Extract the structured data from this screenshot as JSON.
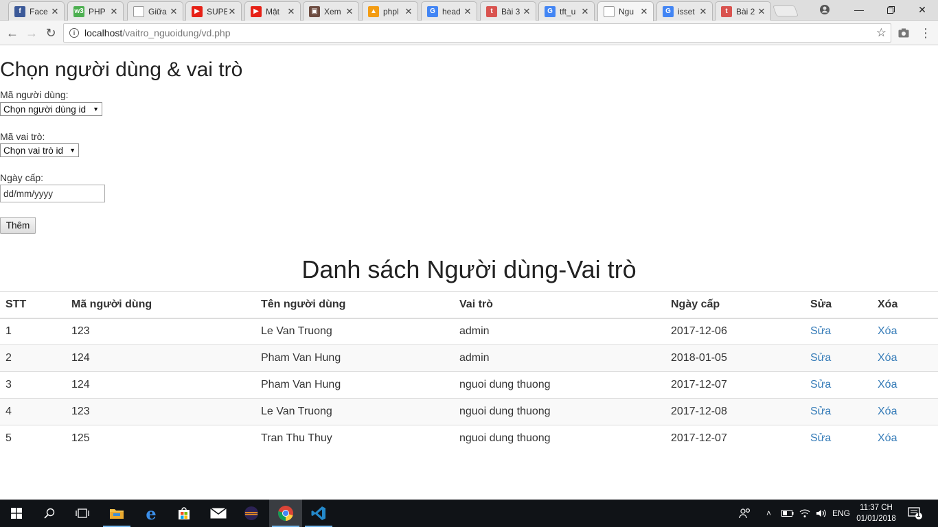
{
  "browser": {
    "tabs": [
      {
        "label": "Face",
        "icon": "facebook-icon",
        "color": "#3b5998",
        "glyph": "f"
      },
      {
        "label": "PHP",
        "icon": "w3schools-icon",
        "color": "#4caf50",
        "glyph": "w3"
      },
      {
        "label": "Giữa",
        "icon": "page-icon",
        "color": "#ffffff",
        "glyph": ""
      },
      {
        "label": "SUPE",
        "icon": "youtube-icon",
        "color": "#e62117",
        "glyph": "▶"
      },
      {
        "label": "Mật",
        "icon": "youtube-icon",
        "color": "#e62117",
        "glyph": "▶"
      },
      {
        "label": "Xem",
        "icon": "video-icon",
        "color": "#6d4c41",
        "glyph": "▣"
      },
      {
        "label": "phpl",
        "icon": "phpmyadmin-icon",
        "color": "#f39c12",
        "glyph": "▲"
      },
      {
        "label": "head",
        "icon": "google-icon",
        "color": "#4285f4",
        "glyph": "G"
      },
      {
        "label": "Bài 3",
        "icon": "t-icon",
        "color": "#d9534f",
        "glyph": "t"
      },
      {
        "label": "tft_u",
        "icon": "google-icon",
        "color": "#4285f4",
        "glyph": "G"
      },
      {
        "label": "Ngu",
        "icon": "page-icon",
        "color": "#ffffff",
        "glyph": "",
        "active": true
      },
      {
        "label": "isset",
        "icon": "google-icon",
        "color": "#4285f4",
        "glyph": "G"
      },
      {
        "label": "Bài 2",
        "icon": "t-icon",
        "color": "#d9534f",
        "glyph": "t"
      }
    ],
    "url_host": "localhost",
    "url_path": "/vaitro_nguoidung/vd.php"
  },
  "form": {
    "title": "Chọn người dùng & vai trò",
    "user_label": "Mã người dùng:",
    "user_select": "Chọn người dùng id",
    "role_label": "Mã vai trò:",
    "role_select": "Chọn vai trò id",
    "date_label": "Ngày cấp:",
    "date_placeholder": "dd/mm/yyyy",
    "submit": "Thêm"
  },
  "list": {
    "title": "Danh sách Người dùng-Vai trò",
    "columns": [
      "STT",
      "Mã người dùng",
      "Tên người dùng",
      "Vai trò",
      "Ngày cấp",
      "Sửa",
      "Xóa"
    ],
    "rows": [
      {
        "stt": "1",
        "ma": "123",
        "ten": "Le Van Truong",
        "vaitro": "admin",
        "ngay": "2017-12-06",
        "sua": "Sửa",
        "xoa": "Xóa"
      },
      {
        "stt": "2",
        "ma": "124",
        "ten": "Pham Van Hung",
        "vaitro": "admin",
        "ngay": "2018-01-05",
        "sua": "Sửa",
        "xoa": "Xóa"
      },
      {
        "stt": "3",
        "ma": "124",
        "ten": "Pham Van Hung",
        "vaitro": "nguoi dung thuong",
        "ngay": "2017-12-07",
        "sua": "Sửa",
        "xoa": "Xóa"
      },
      {
        "stt": "4",
        "ma": "123",
        "ten": "Le Van Truong",
        "vaitro": "nguoi dung thuong",
        "ngay": "2017-12-08",
        "sua": "Sửa",
        "xoa": "Xóa"
      },
      {
        "stt": "5",
        "ma": "125",
        "ten": "Tran Thu Thuy",
        "vaitro": "nguoi dung thuong",
        "ngay": "2017-12-07",
        "sua": "Sửa",
        "xoa": "Xóa"
      }
    ]
  },
  "taskbar": {
    "lang": "ENG",
    "time": "11:37 CH",
    "date": "01/01/2018",
    "notifications": "1"
  }
}
